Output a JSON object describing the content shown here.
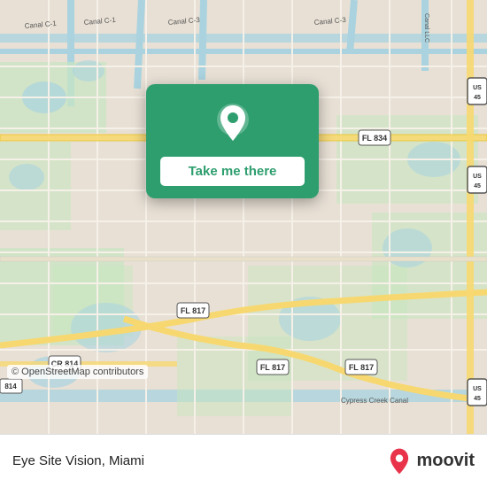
{
  "map": {
    "attribution": "© OpenStreetMap contributors",
    "background_color": "#e8ddd0"
  },
  "card": {
    "take_me_there_label": "Take me there",
    "pin_icon": "location-pin"
  },
  "bottom_bar": {
    "location_name": "Eye Site Vision, Miami",
    "moovit_label": "moovit"
  },
  "road_labels": [
    "FL 834",
    "FL 817",
    "CR 814",
    "US 45",
    "Canal C-1",
    "Canal C-3",
    "Canal LLC",
    "Cypress Creek Canal"
  ]
}
